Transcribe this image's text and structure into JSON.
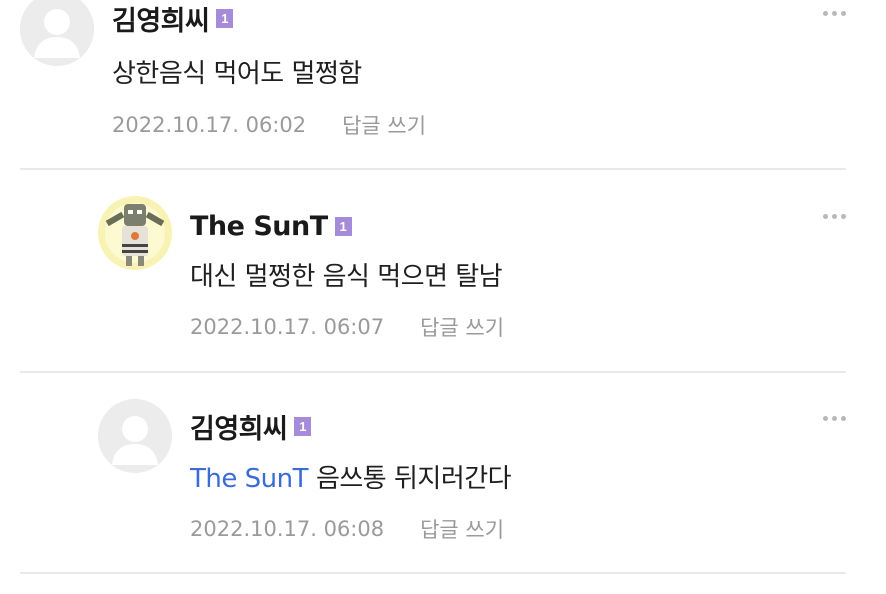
{
  "comments": [
    {
      "author": "김영희씨",
      "level_badge": "1",
      "mention": "",
      "text": "상한음식 먹어도 멀쩡함",
      "timestamp": "2022.10.17. 06:02",
      "reply_label": "답글 쓰기",
      "avatar": "default-avatar-icon"
    },
    {
      "author": "The SunT",
      "level_badge": "1",
      "mention": "",
      "text": "대신 멀쩡한 음식 먹으면 탈남",
      "timestamp": "2022.10.17. 06:07",
      "reply_label": "답글 쓰기",
      "avatar": "character-avatar-icon"
    },
    {
      "author": "김영희씨",
      "level_badge": "1",
      "mention": "The SunT",
      "text": "음쓰통 뒤지러간다",
      "timestamp": "2022.10.17. 06:08",
      "reply_label": "답글 쓰기",
      "avatar": "default-avatar-icon"
    }
  ],
  "colors": {
    "level_badge": "#a58bd8",
    "mention": "#3b6bd6",
    "meta_text": "#9a9a9a",
    "divider": "#e9e9e9"
  }
}
